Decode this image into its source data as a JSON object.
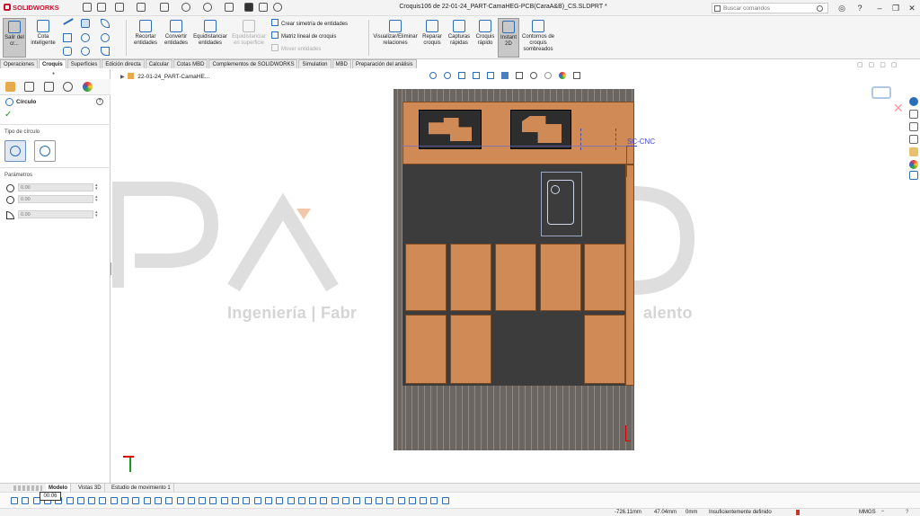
{
  "app": {
    "logo_text": "SOLIDWORKS",
    "document_title": "Croquis106 de 22-01-24_PART-CamaHEG-PCB(CaraA&B)_CS.SLDPRT *",
    "search_placeholder": "Buscar comandos"
  },
  "ribbon": {
    "exit_sketch": "Salir del cr...",
    "smart_dimension": "Cota inteligente",
    "trim": "Recortar entidades",
    "convert": "Convertir entidades",
    "offset": "Equidistanciar entidades",
    "offset_surface": "Equidistanciar en superficie",
    "mirror": "Crear simetría de entidades",
    "linear_pattern": "Matriz lineal de croquis",
    "move": "Mover entidades",
    "relations": "Visualizar/Eliminar relaciones",
    "repair": "Reparar croquis",
    "quick_snaps": "Capturas rápidas",
    "rapid_sketch": "Croquis rápido",
    "instant2d": "Instant 2D",
    "shaded_contours": "Contornos de croquis sombreados"
  },
  "tabs": [
    "Operaciones",
    "Croquis",
    "Superficies",
    "Edición directa",
    "Calcular",
    "Cotas MBD",
    "Complementos de SOLIDWORKS",
    "Simulation",
    "MBD",
    "Preparación del análisis"
  ],
  "active_tab": "Croquis",
  "property_manager": {
    "title": "Círculo",
    "circle_type_header": "Tipo de círculo",
    "params_header": "Parámetros",
    "param_x": "0.00",
    "param_y": "0.00",
    "param_radius": "0.00"
  },
  "viewport": {
    "tree_item": "22-01-24_PART-CamaHE...",
    "watermark_tagline": "Ingeniería | Fabr",
    "watermark_tagline_end": "alento",
    "annotation": "SC-CNC"
  },
  "bottom_tabs": [
    "Modelo",
    "Vistas 3D",
    "Estudio de movimiento 1"
  ],
  "active_bottom_tab": "Modelo",
  "tooltip": "00:06",
  "status": {
    "x": "-726.11mm",
    "y": "47.04mm",
    "z": "0mm",
    "state": "Insuficientemente definido",
    "units": "MMGS"
  },
  "colors": {
    "wood": "#cf8a55",
    "dark_panel": "#3c3c3c",
    "frame": "#6b6662",
    "accent": "#2a6ebb",
    "logo": "#c8102e"
  }
}
